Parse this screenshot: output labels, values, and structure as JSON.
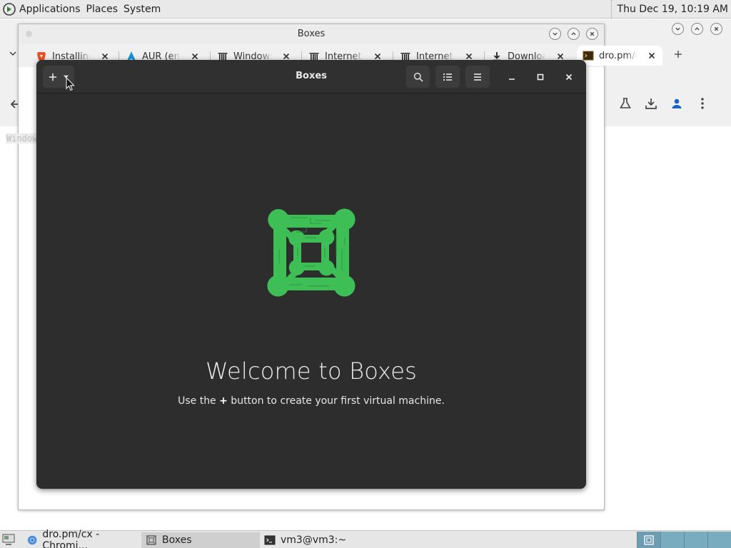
{
  "top_panel": {
    "menus": [
      "Applications",
      "Places",
      "System"
    ],
    "clock": "Thu Dec 19, 10:19 AM"
  },
  "chromium": {
    "window_title": "Boxes",
    "tabs": [
      {
        "label": "Installing",
        "icon": "brave-shield-icon"
      },
      {
        "label": "AUR (en)",
        "icon": "arch-linux-icon"
      },
      {
        "label": "Windows",
        "icon": "internet-archive-icon"
      },
      {
        "label": "Internet A",
        "icon": "internet-archive-icon"
      },
      {
        "label": "Internet A",
        "icon": "internet-archive-icon"
      },
      {
        "label": "Download",
        "icon": "download-icon"
      },
      {
        "label": "dro.pm/c",
        "icon": "terminal-favicon-icon",
        "active": true
      }
    ],
    "page_snippet": "Windows"
  },
  "boxes": {
    "title": "Boxes",
    "welcome_title": "Welcome to Boxes",
    "welcome_pre": "Use the ",
    "welcome_plus": "+",
    "welcome_post": " button to create your first virtual machine."
  },
  "taskbar": {
    "tasks": [
      {
        "label": "dro.pm/cx - Chromi...",
        "icon": "chromium-icon"
      },
      {
        "label": "Boxes",
        "icon": "boxes-icon"
      },
      {
        "label": "vm3@vm3:~",
        "icon": "terminal-icon"
      }
    ]
  },
  "colors": {
    "boxes_bg": "#2d2d2d",
    "boxes_green": "#3dbf55",
    "workspace_blue": "#79acbf"
  }
}
